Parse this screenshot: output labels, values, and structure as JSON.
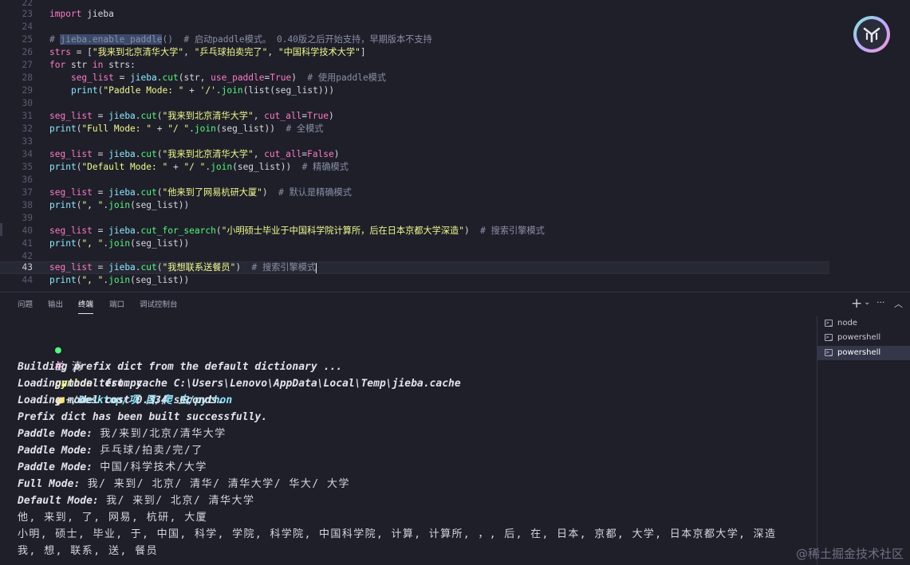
{
  "editor": {
    "line_numbers": [
      "22",
      "23",
      "24",
      "25",
      "26",
      "27",
      "28",
      "29",
      "30",
      "31",
      "32",
      "33",
      "34",
      "35",
      "36",
      "37",
      "38",
      "39",
      "40",
      "41",
      "42",
      "43",
      "44"
    ],
    "l23": {
      "kw": "import",
      "mod": " jieba"
    },
    "l25": {
      "hash": "# ",
      "sel": "jieba.enable_paddle",
      "rest": "()  # 启动paddle模式。 0.40版之后开始支持，早期版本不支持"
    },
    "l26": {
      "var": "strs",
      "eq": " = [",
      "s1": "\"我来到北京清华大学\"",
      "c1": ", ",
      "s2": "\"乒乓球拍卖完了\"",
      "c2": ", ",
      "s3": "\"中国科学技术大学\"",
      "end": "]"
    },
    "l27": {
      "kw1": "for",
      "a": " str ",
      "kw2": "in",
      "b": " strs:"
    },
    "l28": {
      "indent": "    ",
      "var": "seg_list",
      "eq": " = ",
      "obj": "jieba",
      "dot": ".",
      "fn": "cut",
      "args": "(str, ",
      "arg": "use_paddle",
      "eq2": "=",
      "bool": "True",
      "close": ")",
      "cm": "  # 使用paddle模式"
    },
    "l29": {
      "indent": "    ",
      "fn": "print",
      "open": "(",
      "str": "\"Paddle Mode: \"",
      "plus": " + ",
      "str2": "'/'",
      "dot": ".",
      "fn2": "join",
      "args": "(list(seg_list)))"
    },
    "l31": {
      "var": "seg_list",
      "eq": " = ",
      "obj": "jieba",
      "dot": ".",
      "fn": "cut",
      "open": "(",
      "str": "\"我来到北京清华大学\"",
      "comma": ", ",
      "arg": "cut_all",
      "eq2": "=",
      "bool": "True",
      "close": ")"
    },
    "l32": {
      "fn": "print",
      "open": "(",
      "str": "\"Full Mode: \"",
      "plus": " + ",
      "str2": "\"/ \"",
      "dot": ".",
      "fn2": "join",
      "args": "(seg_list))",
      "cm": "  # 全模式"
    },
    "l34": {
      "var": "seg_list",
      "eq": " = ",
      "obj": "jieba",
      "dot": ".",
      "fn": "cut",
      "open": "(",
      "str": "\"我来到北京清华大学\"",
      "comma": ", ",
      "arg": "cut_all",
      "eq2": "=",
      "bool": "False",
      "close": ")"
    },
    "l35": {
      "fn": "print",
      "open": "(",
      "str": "\"Default Mode: \"",
      "plus": " + ",
      "str2": "\"/ \"",
      "dot": ".",
      "fn2": "join",
      "args": "(seg_list))",
      "cm": "  # 精确模式"
    },
    "l37": {
      "var": "seg_list",
      "eq": " = ",
      "obj": "jieba",
      "dot": ".",
      "fn": "cut",
      "open": "(",
      "str": "\"他来到了网易杭研大厦\"",
      "close": ")",
      "cm": "  # 默认是精确模式"
    },
    "l38": {
      "fn": "print",
      "open": "(",
      "str": "\", \"",
      "dot": ".",
      "fn2": "join",
      "args": "(seg_list))"
    },
    "l40": {
      "var": "seg_list",
      "eq": " = ",
      "obj": "jieba",
      "dot": ".",
      "fn": "cut_for_search",
      "open": "(",
      "str": "\"小明硕士毕业于中国科学院计算所，后在日本京都大学深造\"",
      "close": ")",
      "cm": "  # 搜索引擎模式"
    },
    "l41": {
      "fn": "print",
      "open": "(",
      "str": "\", \"",
      "dot": ".",
      "fn2": "join",
      "args": "(seg_list))"
    },
    "l43": {
      "var": "seg_list",
      "eq": " = ",
      "obj": "jieba",
      "dot": ".",
      "fn": "cut",
      "open": "(",
      "str": "\"我想联系送餐员\"",
      "close": ")",
      "cm": "  # 搜索引擎模式"
    },
    "l44": {
      "fn": "print",
      "open": "(",
      "str": "\", \"",
      "dot": ".",
      "fn2": "join",
      "args": "(seg_list))"
    }
  },
  "panel": {
    "tabs": [
      "问题",
      "输出",
      "终端",
      "端口",
      "调试控制台"
    ],
    "active_tab": "终端",
    "actions": {
      "add": "+",
      "chevron": "⌄",
      "more": "···",
      "collapse": "︿"
    }
  },
  "terminal": {
    "prompt": {
      "user": "兰 涛",
      "on": "on",
      "folder_icon": "📁",
      "path": "~/Desktop/项 目/爬 虫/python"
    },
    "command": {
      "hash": "#",
      "cmd": "python",
      "arg": " test.py"
    },
    "log": [
      "Building prefix dict from the default dictionary ...",
      "Loading model from cache C:\\Users\\Lenovo\\AppData\\Local\\Temp\\jieba.cache",
      "Loading model cost 0.334 seconds.",
      "Prefix dict has been built successfully."
    ],
    "results": [
      {
        "label": "Paddle Mode:",
        "value": " 我/来到/北京/清华大学"
      },
      {
        "label": "Paddle Mode:",
        "value": " 乒乓球/拍卖/完/了"
      },
      {
        "label": "Paddle Mode:",
        "value": " 中国/科学技术/大学"
      },
      {
        "label": "Full Mode:",
        "value": " 我/ 来到/ 北京/ 清华/ 清华大学/ 华大/ 大学"
      },
      {
        "label": "Default Mode:",
        "value": " 我/ 来到/ 北京/ 清华大学"
      }
    ],
    "plain": [
      "他, 来到, 了, 网易, 杭研, 大厦",
      "小明, 硕士, 毕业, 于, 中国, 科学, 学院, 科学院, 中国科学院, 计算, 计算所, ，, 后, 在, 日本, 京都, 大学, 日本京都大学, 深造",
      "我, 想, 联系, 送, 餐员"
    ]
  },
  "sessions": [
    {
      "label": "node",
      "active": false
    },
    {
      "label": "powershell",
      "active": false
    },
    {
      "label": "powershell",
      "active": true
    }
  ],
  "watermark": "@稀土掘金技术社区"
}
